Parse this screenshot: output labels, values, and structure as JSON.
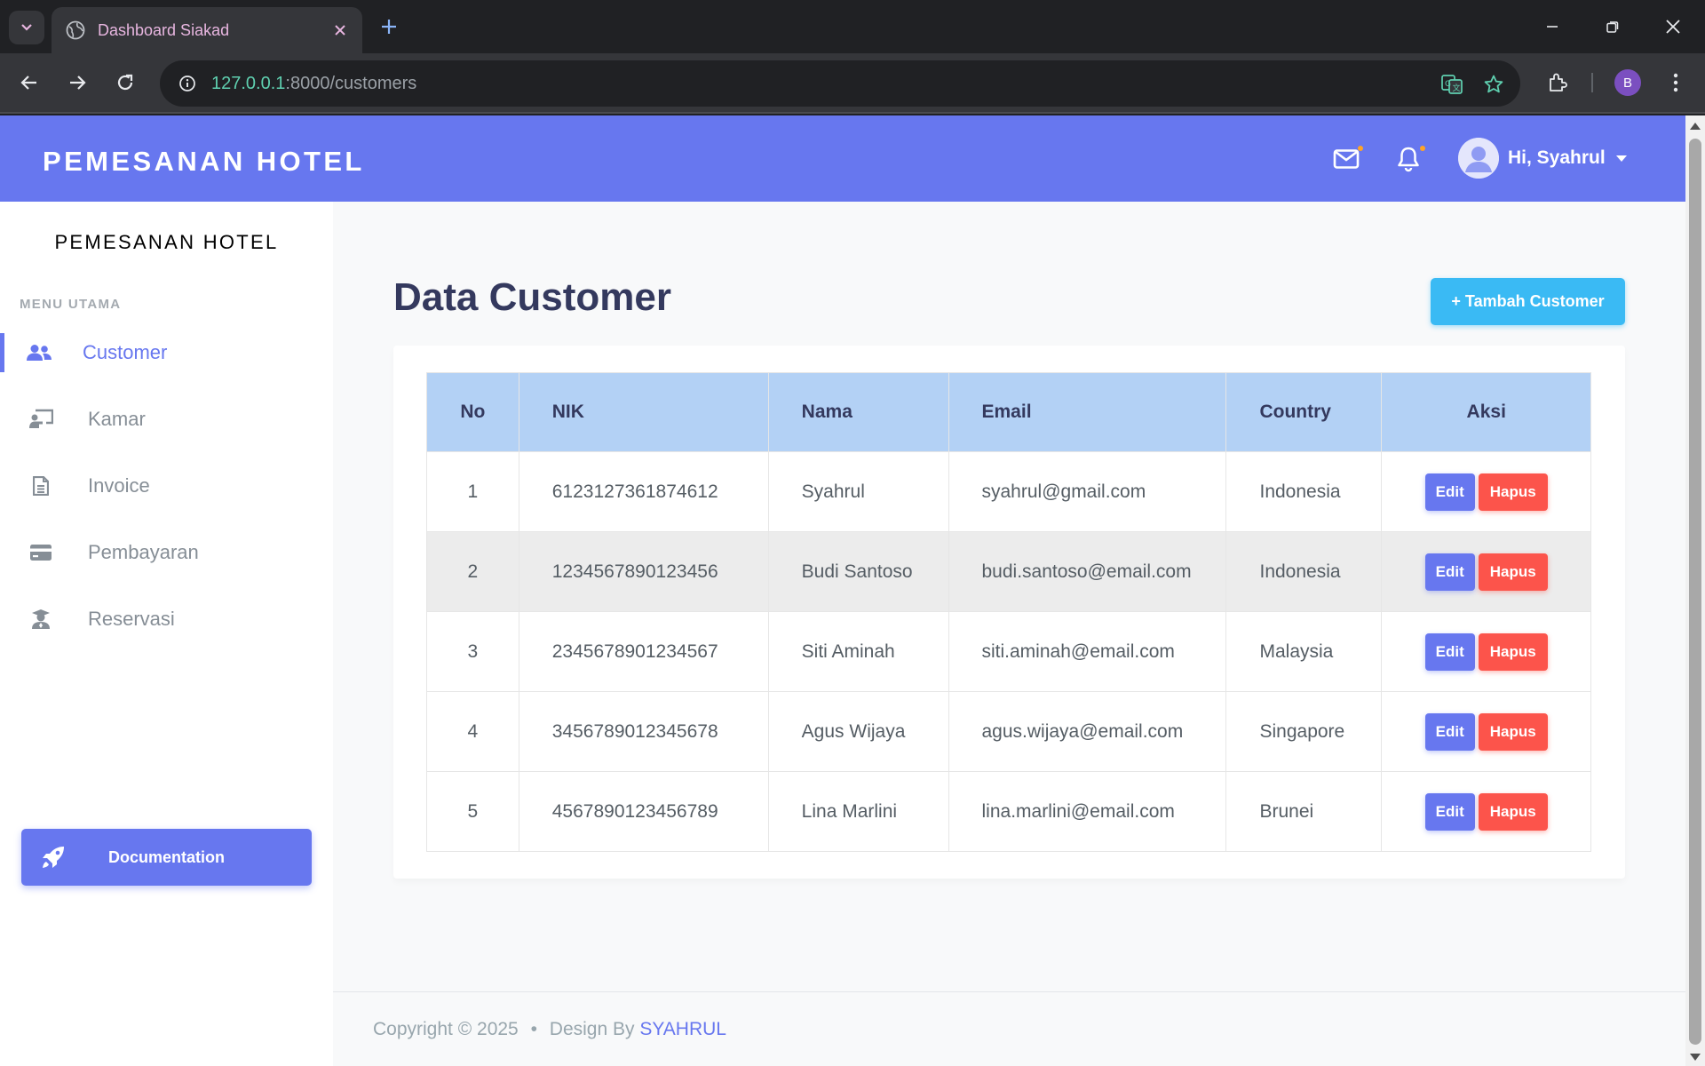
{
  "browser": {
    "tab_title": "Dashboard Siakad",
    "url_host": "127.0.0.1",
    "url_rest": ":8000/customers",
    "profile_initial": "B"
  },
  "navbar": {
    "brand": "PEMESANAN HOTEL",
    "user_greeting": "Hi, Syahrul"
  },
  "sidebar": {
    "brand": "PEMESANAN HOTEL",
    "menu_header": "MENU UTAMA",
    "items": [
      {
        "label": "Customer",
        "icon": "users-icon",
        "active": true
      },
      {
        "label": "Kamar",
        "icon": "chalkboard-user-icon",
        "active": false
      },
      {
        "label": "Invoice",
        "icon": "file-alt-icon",
        "active": false
      },
      {
        "label": "Pembayaran",
        "icon": "credit-card-icon",
        "active": false
      },
      {
        "label": "Reservasi",
        "icon": "user-graduate-icon",
        "active": false
      }
    ],
    "doc_button": "Documentation"
  },
  "main": {
    "title": "Data Customer",
    "add_button": "+ Tambah Customer",
    "table": {
      "headers": [
        "No",
        "NIK",
        "Nama",
        "Email",
        "Country",
        "Aksi"
      ],
      "rows": [
        {
          "no": "1",
          "nik": "6123127361874612",
          "nama": "Syahrul",
          "email": "syahrul@gmail.com",
          "country": "Indonesia"
        },
        {
          "no": "2",
          "nik": "1234567890123456",
          "nama": "Budi Santoso",
          "email": "budi.santoso@email.com",
          "country": "Indonesia"
        },
        {
          "no": "3",
          "nik": "2345678901234567",
          "nama": "Siti Aminah",
          "email": "siti.aminah@email.com",
          "country": "Malaysia"
        },
        {
          "no": "4",
          "nik": "3456789012345678",
          "nama": "Agus Wijaya",
          "email": "agus.wijaya@email.com",
          "country": "Singapore"
        },
        {
          "no": "5",
          "nik": "4567890123456789",
          "nama": "Lina Marlini",
          "email": "lina.marlini@email.com",
          "country": "Brunei"
        }
      ],
      "edit_label": "Edit",
      "delete_label": "Hapus"
    }
  },
  "footer": {
    "copyright": "Copyright © 2025",
    "separator": "•",
    "design_by": "Design By",
    "author": "SYAHRUL"
  },
  "colors": {
    "primary": "#6777ef",
    "info": "#3abaf4",
    "danger": "#fc544b",
    "table_header": "#b3d1f5"
  }
}
